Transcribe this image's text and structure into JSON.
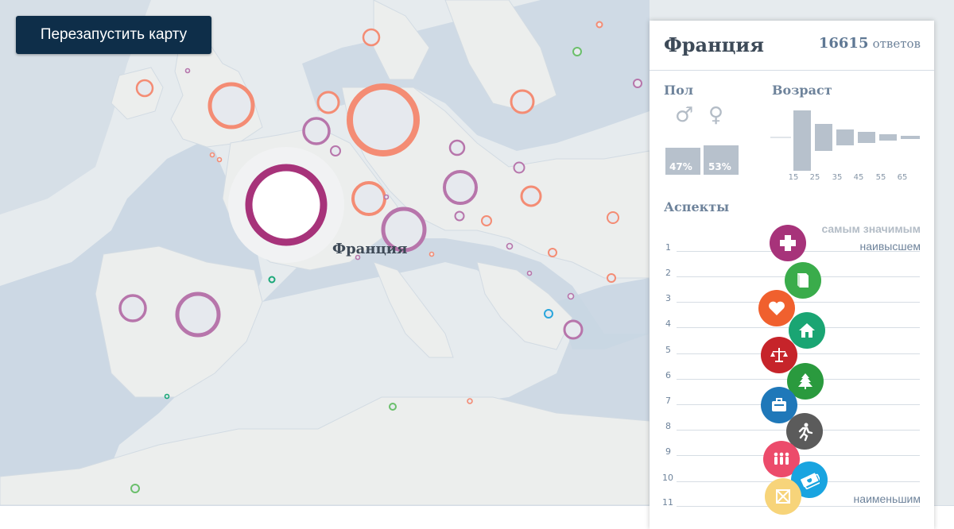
{
  "map": {
    "restart_label": "Перезапустить карту",
    "selected_country_label": "Франция",
    "colors": {
      "water": "#c9d6e2",
      "land": "#e8ebea",
      "orange": "#f48c74",
      "purple": "#b775ab",
      "green": "#6bbf6b",
      "teal": "#1ba878",
      "blue": "#2aa6dc",
      "selected": "#a7337a"
    }
  },
  "panel": {
    "country": "Франция",
    "answers_count": "16615",
    "answers_label": "ответов",
    "gender": {
      "title": "Пол",
      "male_symbol": "♂",
      "female_symbol": "♀",
      "male_pct": "47%",
      "female_pct": "53%"
    },
    "age": {
      "title": "Возраст",
      "ticks": [
        "15",
        "25",
        "35",
        "45",
        "55",
        "65"
      ]
    },
    "aspects": {
      "title": "Аспекты",
      "scale_top": "самым значимым",
      "scale_high": "наивысшем",
      "scale_low": "наименьшим",
      "ranks": [
        "1",
        "2",
        "3",
        "4",
        "5",
        "6",
        "7",
        "8",
        "9",
        "10",
        "11"
      ],
      "items": [
        {
          "name": "health-icon",
          "color": "#a7337a"
        },
        {
          "name": "education-icon",
          "color": "#3aac4b"
        },
        {
          "name": "life-satisfaction-icon",
          "color": "#f0602e"
        },
        {
          "name": "housing-icon",
          "color": "#1aa573"
        },
        {
          "name": "civic-engagement-icon",
          "color": "#c6242a"
        },
        {
          "name": "environment-icon",
          "color": "#2a9a3e"
        },
        {
          "name": "jobs-icon",
          "color": "#1f78b9"
        },
        {
          "name": "work-life-balance-icon",
          "color": "#5b5b5b"
        },
        {
          "name": "community-icon",
          "color": "#ec4b6b"
        },
        {
          "name": "income-icon",
          "color": "#19a4e0"
        },
        {
          "name": "safety-icon",
          "color": "#f7d47a"
        }
      ]
    }
  }
}
